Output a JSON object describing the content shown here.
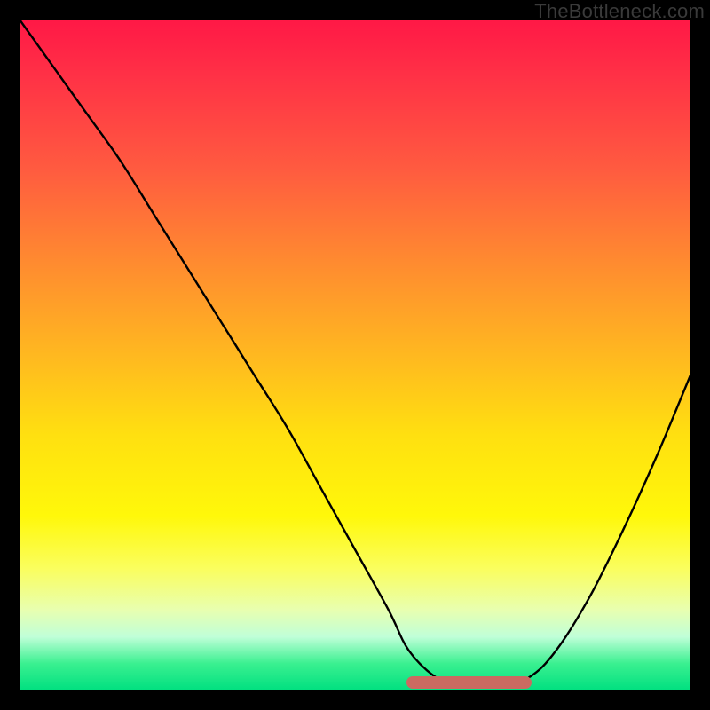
{
  "watermark": "TheBottleneck.com",
  "colors": {
    "frame": "#000000",
    "curve": "#000000",
    "marker": "#cb6a61"
  },
  "chart_data": {
    "type": "line",
    "title": "",
    "xlabel": "",
    "ylabel": "",
    "xlim": [
      0,
      100
    ],
    "ylim": [
      0,
      100
    ],
    "grid": false,
    "legend": false,
    "series": [
      {
        "name": "bottleneck-curve",
        "x": [
          0,
          5,
          10,
          15,
          20,
          25,
          30,
          35,
          40,
          45,
          50,
          55,
          58,
          62,
          65,
          68,
          72,
          76,
          80,
          85,
          90,
          95,
          100
        ],
        "y": [
          100,
          93,
          86,
          79,
          71,
          63,
          55,
          47,
          39,
          30,
          21,
          12,
          6,
          2,
          1,
          1,
          1,
          2,
          6,
          14,
          24,
          35,
          47
        ]
      }
    ],
    "annotations": [
      {
        "name": "optimal-range-marker",
        "type": "segment",
        "x_start": 58,
        "x_end": 76,
        "y": 1
      }
    ]
  }
}
